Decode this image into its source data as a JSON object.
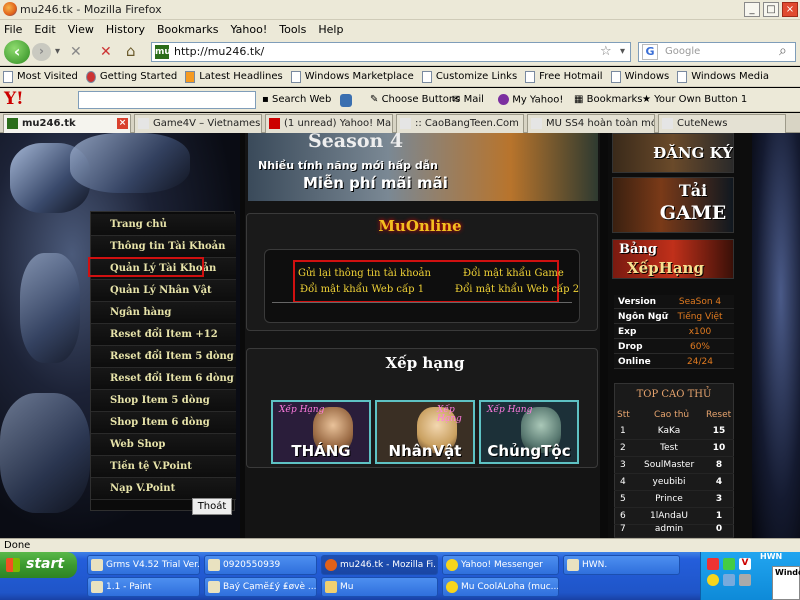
{
  "window": {
    "title": "mu246.tk - Mozilla Firefox",
    "min": "_",
    "max": "□",
    "close": "×"
  },
  "menu": [
    "File",
    "Edit",
    "View",
    "History",
    "Bookmarks",
    "Yahoo!",
    "Tools",
    "Help"
  ],
  "nav": {
    "back": "‹",
    "forward": "›",
    "dropdown": "▾",
    "stop": "✕",
    "home": "⌂",
    "url": "http://mu246.tk/",
    "star": "☆",
    "url_drop": "▾",
    "search_engine": "G",
    "search_placeholder": "Google",
    "search_icon": "⌕"
  },
  "bookmarks": [
    "Most Visited",
    "Getting Started",
    "Latest Headlines",
    "Windows Marketplace",
    "Customize Links",
    "Free Hotmail",
    "Windows",
    "Windows Media"
  ],
  "yahoo_toolbar": {
    "logo": "Y!",
    "search_web": "Search Web",
    "choose_buttons": "Choose Buttons",
    "mail": "Mail",
    "my_yahoo": "My Yahoo!",
    "bookmarks": "Bookmarks",
    "own_button": "Your Own Button 1"
  },
  "tabs": [
    {
      "label": "mu246.tk",
      "active": true
    },
    {
      "label": "Game4V – Vietnamese...",
      "active": false
    },
    {
      "label": "(1 unread) Yahoo! Ma...",
      "active": false
    },
    {
      "label": ":: CaoBangTeen.Com ::...",
      "active": false
    },
    {
      "label": "MU SS4 hoàn toàn mớ...",
      "active": false
    },
    {
      "label": "CuteNews",
      "active": false
    }
  ],
  "banner": {
    "season": "Season 4",
    "line1": "Nhiều tính năng mới hấp dẫn",
    "line2": "Miễn phí mãi mãi"
  },
  "left_menu": [
    "Trang chủ",
    "Thông tin Tài Khoản",
    "Quản Lý Tài Khoản",
    "Quản Lý Nhân Vật",
    "Ngân hàng",
    "Reset đổi Item +12",
    "Reset đổi Item 5 dòng",
    "Reset đổi Item 6 dòng",
    "Shop Item 5 dòng",
    "Shop Item 6 dòng",
    "Web Shop",
    "Tiền tệ V.Point",
    "Nạp V.Point"
  ],
  "thoat": "Thoát",
  "muonline": {
    "title": "MuOnline",
    "links": [
      "Gửi lại thông tin tài khoản",
      "Đổi mật khẩu Game",
      "Đổi mật khẩu Web cấp 1",
      "Đổi mật khẩu Web cấp 2"
    ]
  },
  "xephang": {
    "title": "Xếp hạng",
    "cards": [
      {
        "small": "Xếp Hạng",
        "big": "THÁNG"
      },
      {
        "small": "Xếp Hạng",
        "big": "NhânVật"
      },
      {
        "small": "Xếp Hạng",
        "big": "ChủngTộc"
      }
    ]
  },
  "right_banners": {
    "dang_ky": "ĐĂNG KÝ",
    "tai_game_1": "Tải",
    "tai_game_2": "GAME",
    "bang_1": "Bảng",
    "bang_2": "XếpHạng"
  },
  "server_info": [
    {
      "k": "Version",
      "v": "SeaSon 4"
    },
    {
      "k": "Ngôn Ngữ",
      "v": "Tiếng Việt"
    },
    {
      "k": "Exp",
      "v": "x100"
    },
    {
      "k": "Drop",
      "v": "60%"
    },
    {
      "k": "Online",
      "v": "24/24"
    }
  ],
  "top": {
    "title": "TOP CAO THỦ",
    "headers": [
      "Stt",
      "Cao thủ",
      "Reset"
    ],
    "rows": [
      {
        "stt": "1",
        "name": "KaKa",
        "reset": "15"
      },
      {
        "stt": "2",
        "name": "Test",
        "reset": "10"
      },
      {
        "stt": "3",
        "name": "SoulMaster",
        "reset": "8"
      },
      {
        "stt": "4",
        "name": "yeubibi",
        "reset": "4"
      },
      {
        "stt": "5",
        "name": "Prince",
        "reset": "3"
      },
      {
        "stt": "6",
        "name": "1lAndaU",
        "reset": "1"
      },
      {
        "stt": "7",
        "name": "admin",
        "reset": "0"
      }
    ]
  },
  "status": "Done",
  "taskbar": {
    "start": "start",
    "row1": [
      "Grms V4.52 Trial Ver...",
      "0920550939",
      "mu246.tk - Mozilla Fi...",
      "Yahoo! Messenger",
      "HWN."
    ],
    "row2": [
      "1.1 - Paint",
      "Baý Cạmĕ£ý ₤øvè ...",
      "Mu",
      "Mu CoolALoha (muc..."
    ],
    "tray_label": "HWN",
    "tray_window": "Windo"
  }
}
